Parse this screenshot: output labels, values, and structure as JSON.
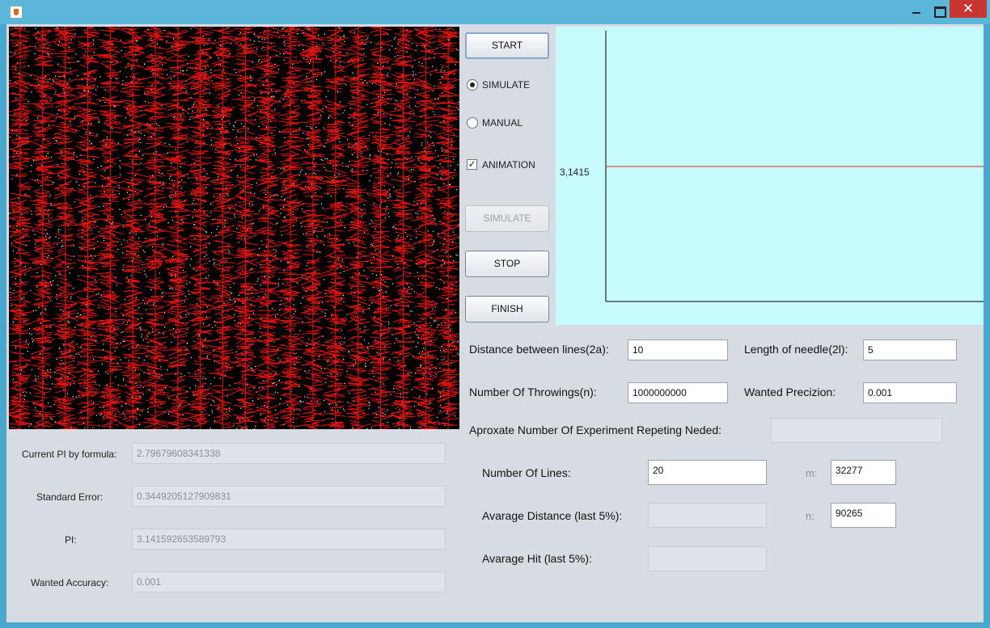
{
  "window": {
    "close_glyph": "✕"
  },
  "stats": {
    "current_pi_label": "Current PI by formula:",
    "current_pi_value": "2.79679608341338",
    "std_error_label": "Standard Error:",
    "std_error_value": "0.3449205127909831",
    "pi_label": "PI:",
    "pi_value": "3.141592653589793",
    "accuracy_label": "Wanted Accuracy:",
    "accuracy_value": "0.001"
  },
  "controls": {
    "start_label": "START",
    "simulate_radio_label": "SIMULATE",
    "simulate_radio_selected": true,
    "manual_radio_label": "MANUAL",
    "manual_radio_selected": false,
    "animation_label": "ANIMATION",
    "animation_checked": true,
    "animation_check_glyph": "✓",
    "simulate_button_label": "SIMULATE",
    "stop_label": "STOP",
    "finish_label": "FINISH"
  },
  "chart_data": {
    "type": "line",
    "ytick_label": "3,1415",
    "reference_value": 3.1415,
    "series": [],
    "line_color": "#cc2a1a",
    "background": "#c8fbfd"
  },
  "form": {
    "distance_label": "Distance between lines(2a):",
    "distance_value": "10",
    "needle_label": "Length of needle(2l):",
    "needle_value": "5",
    "throwings_label": "Number Of Throwings(n):",
    "throwings_value": "1000000000",
    "precizion_label": "Wanted Precizion:",
    "precizion_value": "0.001",
    "repeating_label": "Aproxate Number Of Experiment Repeting Neded:",
    "repeating_value": "",
    "lines_label": "Number Of Lines:",
    "lines_value": "20",
    "m_label": "m:",
    "m_value": "32277",
    "avg_distance_label": "Avarage Distance  (last 5%):",
    "avg_distance_value": "",
    "n_label": "n:",
    "n_value": "90265",
    "avg_hit_label": "Avarage Hit (last 5%):",
    "avg_hit_value": ""
  },
  "colors": {
    "needle": "#e0140f",
    "dot": "#ffffff",
    "canvas_bg": "#000000",
    "panel_bg": "#d7dce3",
    "title_bar": "#5cb6da"
  }
}
